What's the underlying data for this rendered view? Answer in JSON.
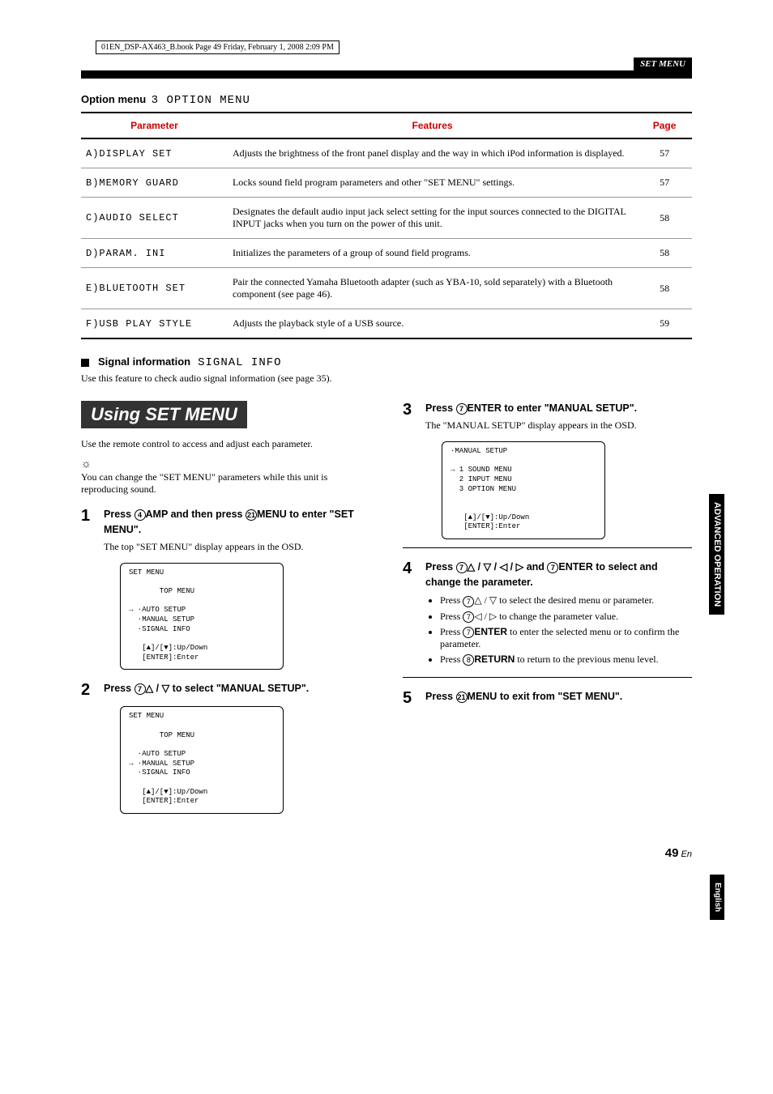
{
  "print_header": "01EN_DSP-AX463_B.book  Page 49  Friday, February 1, 2008  2:09 PM",
  "set_menu_label": "SET MENU",
  "option_menu": {
    "label": "Option menu",
    "code": "3 OPTION MENU"
  },
  "table": {
    "headers": {
      "param": "Parameter",
      "feat": "Features",
      "page": "Page"
    },
    "rows": [
      {
        "param": "A)DISPLAY SET",
        "feat": "Adjusts the brightness of the front panel display and the way in which iPod information is displayed.",
        "page": "57"
      },
      {
        "param": "B)MEMORY GUARD",
        "feat": "Locks sound field program parameters and other \"SET MENU\" settings.",
        "page": "57"
      },
      {
        "param": "C)AUDIO SELECT",
        "feat": "Designates the default audio input jack select setting for the input sources connected to the DIGITAL INPUT jacks when you turn on the power of this unit.",
        "page": "58"
      },
      {
        "param": "D)PARAM. INI",
        "feat": "Initializes the parameters of a group of sound field programs.",
        "page": "58"
      },
      {
        "param": "E)BLUETOOTH SET",
        "feat": "Pair the connected Yamaha Bluetooth adapter (such as YBA-10, sold separately) with a Bluetooth component (see page 46).",
        "page": "58"
      },
      {
        "param": "F)USB PLAY STYLE",
        "feat": "Adjusts the playback style of a USB source.",
        "page": "59"
      }
    ]
  },
  "signal_info": {
    "title": "Signal information",
    "code": "SIGNAL INFO",
    "body": "Use this feature to check audio signal information (see page 35)."
  },
  "using": {
    "heading": "Using SET MENU",
    "intro": "Use the remote control to access and adjust each parameter.",
    "tip": "You can change the \"SET MENU\" parameters while this unit is reproducing sound."
  },
  "steps": {
    "s1": {
      "num": "1",
      "pre": "Press ",
      "c1": "4",
      "k1": "AMP",
      "mid": " and then press ",
      "c2": "21",
      "k2": "MENU",
      "post": " to enter \"SET MENU\".",
      "desc": "The top \"SET MENU\" display appears in the OSD.",
      "osd": "SET MENU\n\n       TOP MENU\n\n→ ∙AUTO SETUP\n  ∙MANUAL SETUP\n  ∙SIGNAL INFO\n\n   [▲]/[▼]:Up/Down\n   [ENTER]:Enter"
    },
    "s2": {
      "num": "2",
      "pre": "Press ",
      "c1": "7",
      "sym": "△ / ▽",
      "post": " to select \"MANUAL SETUP\".",
      "osd": "SET MENU\n\n       TOP MENU\n\n  ∙AUTO SETUP\n→ ∙MANUAL SETUP\n  ∙SIGNAL INFO\n\n   [▲]/[▼]:Up/Down\n   [ENTER]:Enter"
    },
    "s3": {
      "num": "3",
      "pre": "Press ",
      "c1": "7",
      "k1": "ENTER",
      "post": " to enter \"MANUAL SETUP\".",
      "desc": "The \"MANUAL SETUP\" display appears in the OSD.",
      "osd": "∙MANUAL SETUP\n\n→ 1 SOUND MENU\n  2 INPUT MENU\n  3 OPTION MENU\n\n\n   [▲]/[▼]:Up/Down\n   [ENTER]:Enter"
    },
    "s4": {
      "num": "4",
      "pre": "Press ",
      "c1": "7",
      "sym": "△ / ▽ / ◁ / ▷",
      "mid": " and ",
      "c2": "7",
      "k2": "ENTER",
      "post": " to select and change the parameter.",
      "b1": {
        "pre": "Press ",
        "c": "7",
        "sym": "△ / ▽",
        "post": " to select the desired menu or parameter."
      },
      "b2": {
        "pre": "Press ",
        "c": "7",
        "sym": "◁ / ▷",
        "post": " to change the parameter value."
      },
      "b3": {
        "pre": "Press ",
        "c": "7",
        "k": "ENTER",
        "post": " to enter the selected menu or to confirm the parameter."
      },
      "b4": {
        "pre": "Press ",
        "c": "8",
        "k": "RETURN",
        "post": " to return to the previous menu level."
      }
    },
    "s5": {
      "num": "5",
      "pre": "Press ",
      "c1": "21",
      "k1": "MENU",
      "post": " to exit from \"SET MENU\"."
    }
  },
  "side_tabs": {
    "adv": "ADVANCED\nOPERATION",
    "eng": "English"
  },
  "page_num": {
    "num": "49",
    "suf": " En"
  }
}
